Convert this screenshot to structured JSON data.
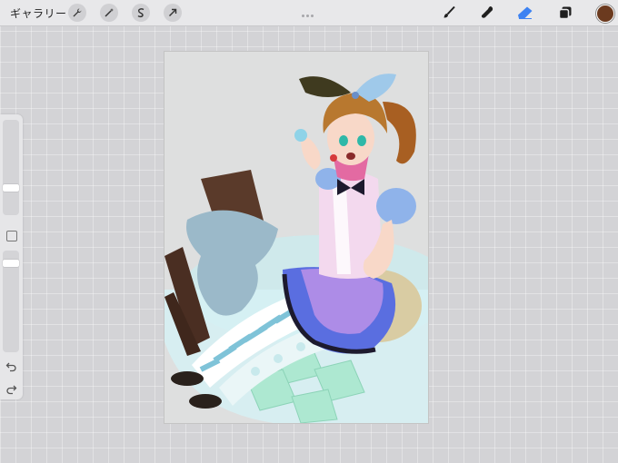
{
  "topbar": {
    "gallery_label": "ギャラリー",
    "actions": [
      {
        "name": "actions",
        "icon": "wrench-icon"
      },
      {
        "name": "adjustments",
        "icon": "magic-wand-icon"
      },
      {
        "name": "selection",
        "icon": "selection-s-icon"
      },
      {
        "name": "transform",
        "icon": "arrow-icon"
      }
    ],
    "tools": [
      {
        "name": "brush",
        "icon": "brush-icon"
      },
      {
        "name": "smudge",
        "icon": "smudge-icon",
        "color": "#1f1f1f"
      },
      {
        "name": "eraser",
        "icon": "eraser-icon",
        "active": true,
        "color": "#3d82f2"
      },
      {
        "name": "layers",
        "icon": "layers-icon"
      }
    ],
    "current_color": "#6b3a1f"
  },
  "sidebar": {
    "brush_size_slider": "brush-size",
    "opacity_slider": "opacity",
    "undo_icon": "undo-icon",
    "redo_icon": "redo-icon",
    "modify_button": "color-modify-square"
  },
  "canvas": {
    "background": "#dedfdf",
    "palette": {
      "hair": "#b8782f",
      "skin": "#f8d8c8",
      "ribbon": "#3f3a1f",
      "dress_blue": "#5a6ee0",
      "dress_purple": "#b68fe8",
      "stocking_stripe": "#7fc3d8",
      "glass_green": "#9fe6c6",
      "chocolate": "#5a3a2a",
      "cream": "#9bb9c9"
    }
  }
}
